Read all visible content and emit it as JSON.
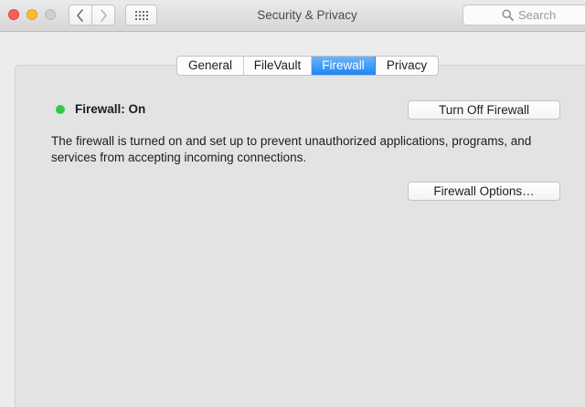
{
  "window": {
    "title": "Security & Privacy"
  },
  "toolbar": {
    "back_icon": "chevron-left-icon",
    "forward_icon": "chevron-right-icon",
    "grid_icon": "grid-icon"
  },
  "search": {
    "placeholder": "Search",
    "icon": "search-icon"
  },
  "tabs": [
    {
      "label": "General",
      "selected": false
    },
    {
      "label": "FileVault",
      "selected": false
    },
    {
      "label": "Firewall",
      "selected": true
    },
    {
      "label": "Privacy",
      "selected": false
    }
  ],
  "firewall": {
    "status_label": "Firewall: On",
    "status_color": "#30c94a",
    "turn_off_label": "Turn Off Firewall",
    "description": "The firewall is turned on and set up to prevent unauthorized applications, programs, and services from accepting incoming connections.",
    "options_label": "Firewall Options…"
  },
  "colors": {
    "selected_tab": "#1f86f5",
    "close": "#fc5f57",
    "minimize": "#fdbc2e",
    "zoom_disabled": "#cfcfcf"
  }
}
